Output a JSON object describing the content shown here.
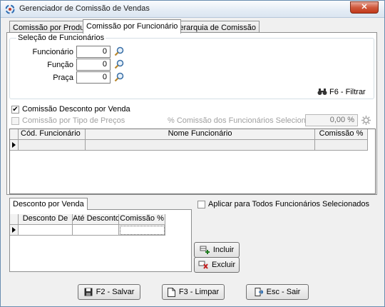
{
  "window": {
    "title": "Gerenciador de Comissão de Vendas",
    "close": "✕"
  },
  "tabs": [
    {
      "label": "Comissão por Produto"
    },
    {
      "label": "Comissão por Funcionário"
    },
    {
      "label": "Hierarquia de Comissão"
    }
  ],
  "selection": {
    "legend": "Seleção de Funcionários",
    "fields": [
      {
        "label": "Funcionário",
        "value": "0"
      },
      {
        "label": "Função",
        "value": "0"
      },
      {
        "label": "Praça",
        "value": "0"
      }
    ],
    "filter": "F6 - Filtrar"
  },
  "options": {
    "desconto_label": "Comissão Desconto por Venda",
    "desconto_checked": true,
    "tipo_precos_label": "Comissão por Tipo de Preços",
    "pct_label": "% Comissão dos Funcionários Selecionados:",
    "pct_value": "0,00 %"
  },
  "grid_funcionarios": {
    "columns": [
      "Cód. Funcionário",
      "Nome Funcionário",
      "Comissão %"
    ]
  },
  "desconto": {
    "tab": "Desconto por Venda",
    "apply_all": "Aplicar para Todos Funcionários Selecionados",
    "columns": [
      "Desconto De",
      "Até Desconto",
      "Comissão %"
    ],
    "include": "Incluir",
    "exclude": "Excluir"
  },
  "footer": {
    "save": "F2 - Salvar",
    "clear": "F3 - Limpar",
    "exit": "Esc - Sair"
  }
}
